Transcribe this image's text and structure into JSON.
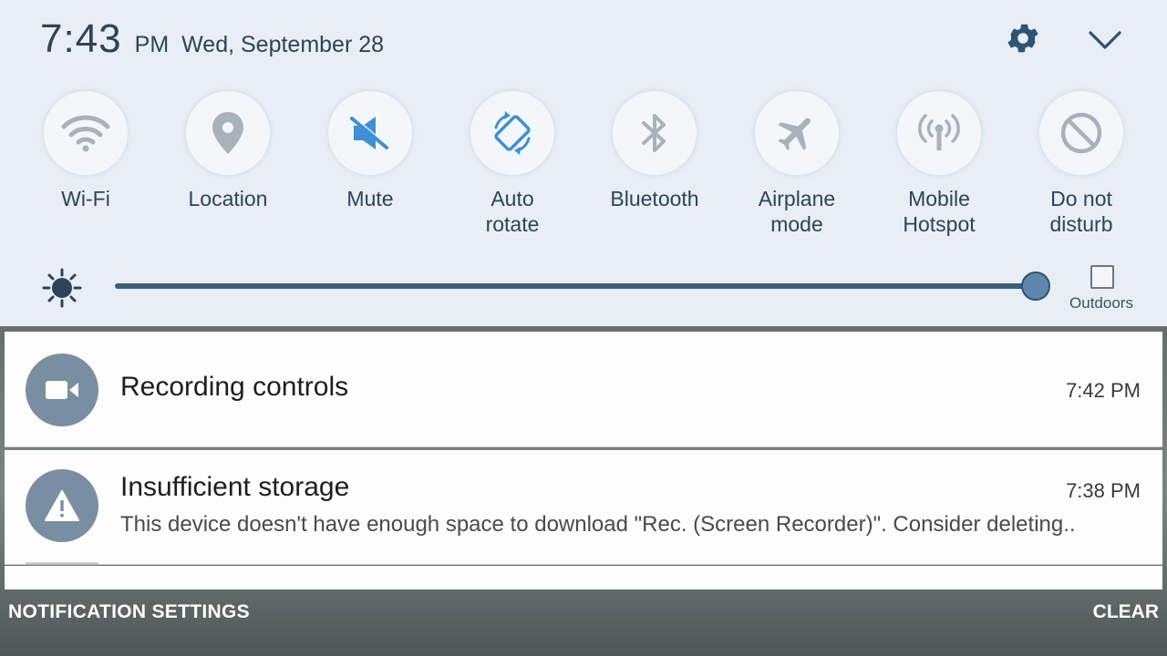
{
  "status": {
    "time": "7:43",
    "ampm": "PM",
    "date": "Wed, September 28"
  },
  "header_icons": [
    "gear-icon",
    "chevron-down-icon"
  ],
  "quick_tiles": [
    {
      "label": "Wi-Fi",
      "icon": "wifi-icon",
      "active": false
    },
    {
      "label": "Location",
      "icon": "location-pin-icon",
      "active": false
    },
    {
      "label": "Mute",
      "icon": "mute-icon",
      "active": true
    },
    {
      "label": "Auto\nrotate",
      "icon": "auto-rotate-icon",
      "active": true
    },
    {
      "label": "Bluetooth",
      "icon": "bluetooth-icon",
      "active": false
    },
    {
      "label": "Airplane\nmode",
      "icon": "airplane-icon",
      "active": false
    },
    {
      "label": "Mobile\nHotspot",
      "icon": "hotspot-icon",
      "active": false
    },
    {
      "label": "Do not\ndisturb",
      "icon": "do-not-disturb-icon",
      "active": false
    }
  ],
  "brightness": {
    "level": 1.0,
    "outdoors_label": "Outdoors",
    "outdoors_checked": false
  },
  "notifications": [
    {
      "title": "Recording controls",
      "time": "7:42 PM",
      "icon": "video-camera-icon"
    },
    {
      "title": "Insufficient storage",
      "time": "7:38 PM",
      "icon": "warning-icon",
      "body": "This device doesn't have enough space to download \"Rec. (Screen Recorder)\". Consider deleting.."
    }
  ],
  "footer": {
    "left": "NOTIFICATION SETTINGS",
    "right": "CLEAR"
  },
  "colors": {
    "panel_bg": "#e8eef4",
    "text_primary": "#2c4459",
    "icon_inactive": "#a3adb7",
    "icon_active": "#3f8fd6",
    "slider": "#3b5d7d"
  }
}
